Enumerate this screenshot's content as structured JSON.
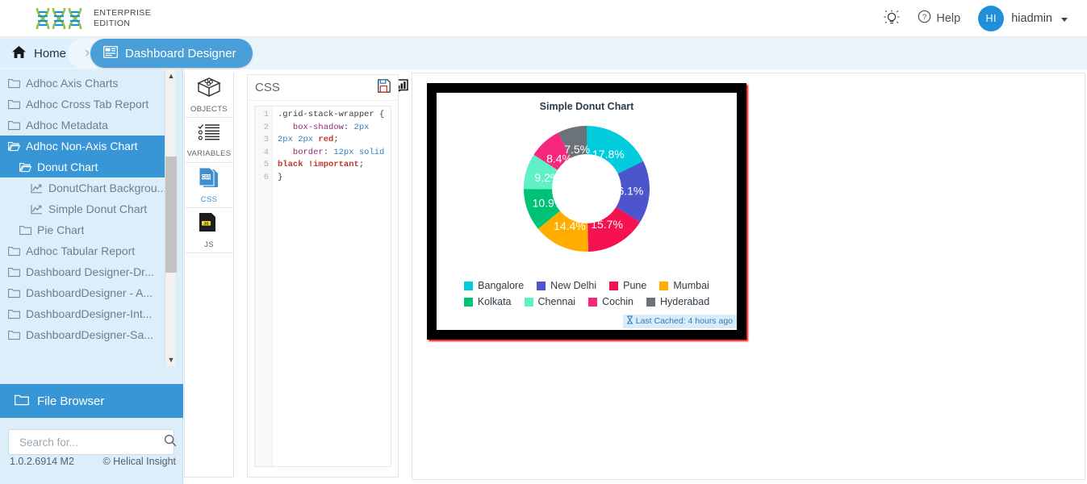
{
  "header": {
    "brand_line1": "ENTERPRISE",
    "brand_line2": "EDITION",
    "logo_icon": "dna-logo-icon",
    "bulb_icon": "lightbulb-icon",
    "help_icon": "question-circle-icon",
    "help_label": "Help",
    "avatar_initials": "HI",
    "user_name": "hiadmin"
  },
  "breadcrumb": {
    "home_label": "Home",
    "home_icon": "home-icon",
    "separator": "›",
    "current_label": "Dashboard Designer",
    "current_icon": "dashboard-icon"
  },
  "toolbar": {
    "items": [
      {
        "name": "layout-button",
        "icon": "layout-grid-icon",
        "has_caret": true
      },
      {
        "name": "save-button",
        "icon": "floppy-disk-icon",
        "has_caret": true
      },
      {
        "name": "preview-button",
        "icon": "preview-eye-icon",
        "has_caret": false
      },
      {
        "name": "refresh-button",
        "icon": "refresh-icon",
        "has_caret": false
      },
      {
        "name": "chart-button",
        "icon": "chart-easel-icon",
        "has_caret": false
      }
    ]
  },
  "sidebar": {
    "tree": [
      {
        "label": "Adhoc Axis Charts",
        "icon": "folder-icon",
        "indent": 0,
        "selected": false
      },
      {
        "label": "Adhoc Cross Tab Report",
        "icon": "folder-icon",
        "indent": 0,
        "selected": false
      },
      {
        "label": "Adhoc Metadata",
        "icon": "folder-icon",
        "indent": 0,
        "selected": false
      },
      {
        "label": "Adhoc Non-Axis Chart",
        "icon": "folder-open-icon",
        "indent": 0,
        "selected": true
      },
      {
        "label": "Donut Chart",
        "icon": "folder-open-icon",
        "indent": 1,
        "selected": true
      },
      {
        "label": "DonutChart Backgrou...",
        "icon": "chart-line-icon",
        "indent": 2,
        "selected": false
      },
      {
        "label": "Simple Donut Chart",
        "icon": "chart-line-icon",
        "indent": 2,
        "selected": false
      },
      {
        "label": "Pie Chart",
        "icon": "folder-icon",
        "indent": 1,
        "selected": false
      },
      {
        "label": "Adhoc Tabular Report",
        "icon": "folder-icon",
        "indent": 0,
        "selected": false
      },
      {
        "label": "Dashboard Designer-Dr...",
        "icon": "folder-icon",
        "indent": 0,
        "selected": false
      },
      {
        "label": "DashboardDesigner - A...",
        "icon": "folder-icon",
        "indent": 0,
        "selected": false
      },
      {
        "label": "DashboardDesigner-Int...",
        "icon": "folder-icon",
        "indent": 0,
        "selected": false
      },
      {
        "label": "DashboardDesigner-Sa...",
        "icon": "folder-icon",
        "indent": 0,
        "selected": false
      }
    ],
    "file_browser_label": "File Browser",
    "file_browser_icon": "folder-icon",
    "search_placeholder": "Search for...",
    "search_value": "",
    "search_icon": "search-icon",
    "version": "1.0.2.6914 M2",
    "copyright": "© Helical Insight"
  },
  "panel_strip": [
    {
      "label": "OBJECTS",
      "icon": "objects-box-icon",
      "active": false
    },
    {
      "label": "VARIABLES",
      "icon": "variables-list-icon",
      "active": false
    },
    {
      "label": "CSS",
      "icon": "css-file-icon",
      "active": true
    },
    {
      "label": "JS",
      "icon": "js-file-icon",
      "active": false
    }
  ],
  "editor": {
    "title": "CSS",
    "save_icon": "save-file-icon",
    "line_numbers": [
      "1",
      "2",
      "3",
      "4",
      "5",
      "6"
    ],
    "code_tokens": [
      {
        "t": ".grid-stack-wrapper {",
        "c": "k-sel"
      },
      {
        "t": "\n   ",
        "c": "k-sel"
      },
      {
        "t": "box-shadow",
        "c": "k-prop"
      },
      {
        "t": ": ",
        "c": "k-sel"
      },
      {
        "t": "2px 2px 2px",
        "c": "k-val"
      },
      {
        "t": " ",
        "c": "k-sel"
      },
      {
        "t": "red",
        "c": "k-kw"
      },
      {
        "t": ";\n   ",
        "c": "k-sel"
      },
      {
        "t": "border",
        "c": "k-prop"
      },
      {
        "t": ": ",
        "c": "k-sel"
      },
      {
        "t": "12px solid",
        "c": "k-val"
      },
      {
        "t": " ",
        "c": "k-sel"
      },
      {
        "t": "black",
        "c": "k-kw"
      },
      {
        "t": " ",
        "c": "k-sel"
      },
      {
        "t": "!important",
        "c": "k-imp"
      },
      {
        "t": ";\n}",
        "c": "k-sel"
      }
    ]
  },
  "chart_data": {
    "type": "pie",
    "variant": "donut",
    "title": "Simple Donut Chart",
    "categories": [
      "Bangalore",
      "New Delhi",
      "Pune",
      "Mumbai",
      "Kolkata",
      "Chennai",
      "Cochin",
      "Hyderabad"
    ],
    "values": [
      17.8,
      16.1,
      15.7,
      14.4,
      10.9,
      9.2,
      8.4,
      7.5
    ],
    "value_labels": [
      "17.8%",
      "16.1%",
      "15.7%",
      "14.4%",
      "10.9%",
      "9.2%",
      "8.4%",
      "7.5%"
    ],
    "colors": [
      "#00ccdd",
      "#4c55cc",
      "#f5124f",
      "#ffae00",
      "#00c277",
      "#5ff0c8",
      "#f6287c",
      "#6b7278"
    ],
    "legend_position": "bottom",
    "grid": false,
    "start_angle": 0,
    "inner_radius_ratio": 0.55,
    "cached_icon": "hourglass-icon",
    "cached_label": "Last Cached: 4 hours ago"
  }
}
